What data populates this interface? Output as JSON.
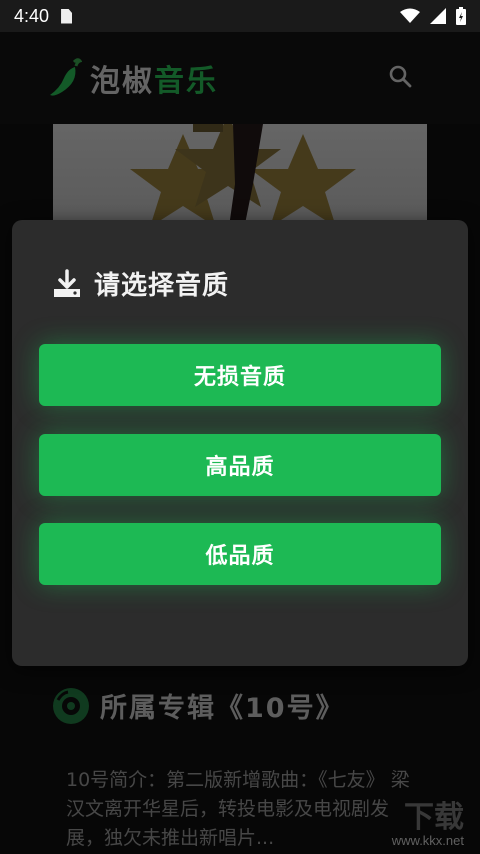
{
  "status_bar": {
    "time": "4:40"
  },
  "header": {
    "app_name_part1": "泡椒",
    "app_name_part2": "音乐",
    "icons": [
      "chili-logo-icon",
      "search-icon"
    ]
  },
  "album": {
    "title": "所属专辑《10号》",
    "intro": "10号简介：第二版新增歌曲：《七友》 梁汉文离开华星后，转投电影及电视剧发展，独欠未推出新唱片..."
  },
  "dialog": {
    "title": "请选择音质",
    "options": [
      {
        "label": "无损音质"
      },
      {
        "label": "高品质"
      },
      {
        "label": "低品质"
      }
    ]
  },
  "watermark": {
    "text": "www.kkx.net",
    "big": "下载"
  },
  "colors": {
    "accent": "#1db954",
    "brand_green": "#1e8a3e",
    "dialog_bg": "#2c2c2c",
    "background": "#0b0b0b"
  }
}
